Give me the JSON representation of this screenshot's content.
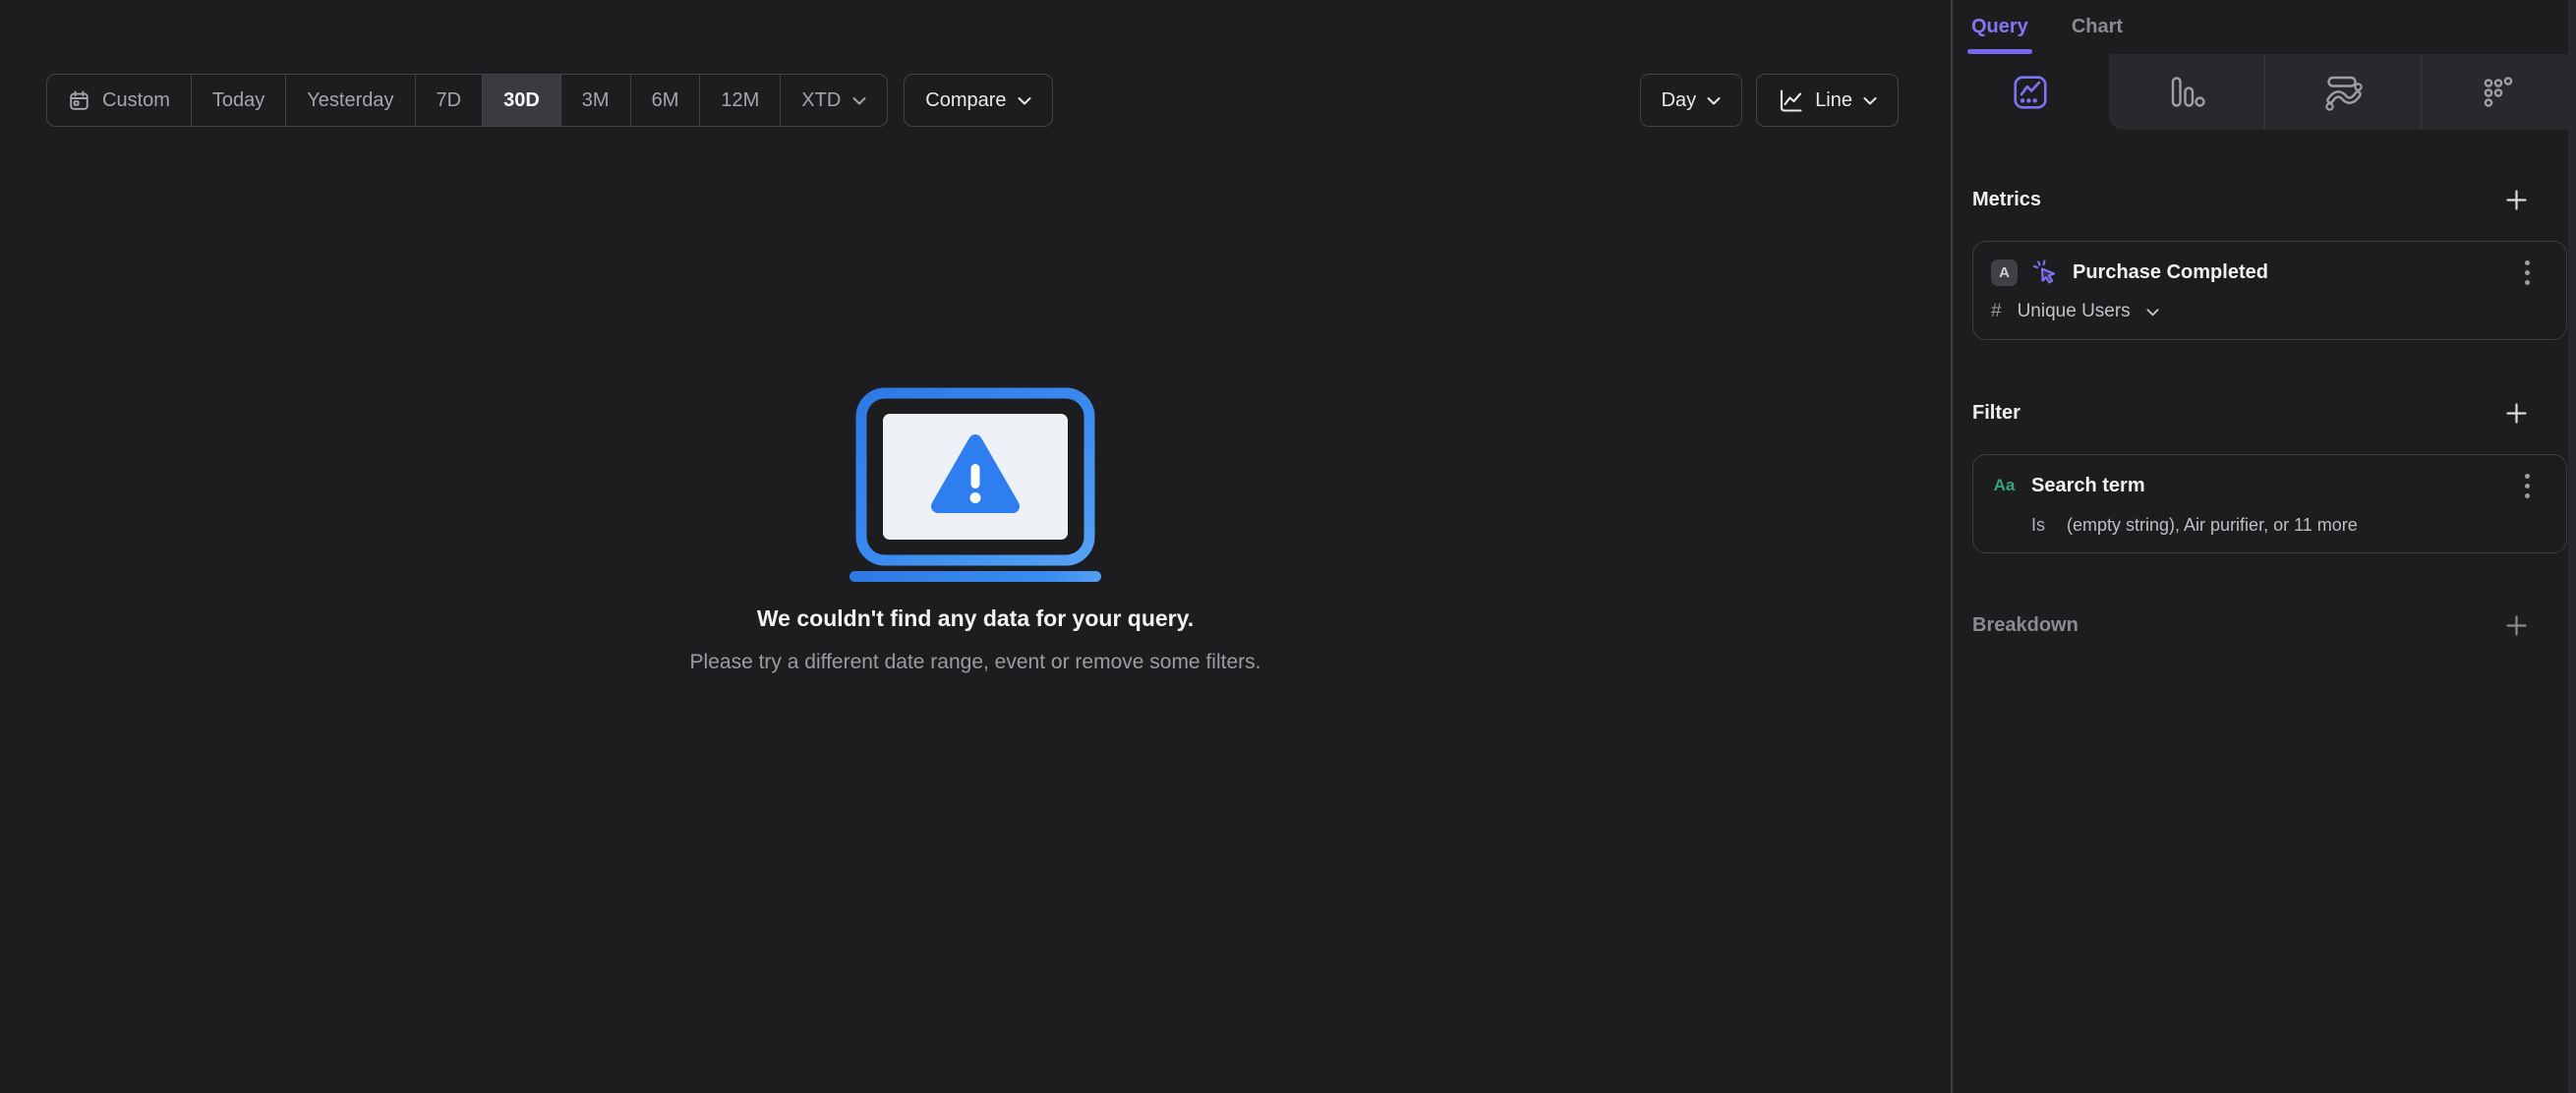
{
  "colors": {
    "accent_purple": "#7c6ff0",
    "accent_green": "#34a77c",
    "accent_blue": "#2e7ef0",
    "selected_segment_bg": "#3a3a40",
    "page_bg": "#1d1d20",
    "tabstrip_bg": "#29292d"
  },
  "icons": {
    "calendar-icon": "calendar outline",
    "chevron-down-icon": "⌄",
    "line-chart-icon": "zigzag line over axis",
    "insights-icon": "trend line in rounded square",
    "funnels-icon": "descending bars with dot",
    "flows-icon": "bar over s-curve ribbon with dots",
    "retention-icon": "triangular grid of hollow dots",
    "cursor-click-icon": "pointer with sparkle rays",
    "kebab-menu-icon": "⋮",
    "plus-icon": "+",
    "hash-symbol": "#",
    "text-property-icon": "Aa",
    "warning-laptop-illustration": "laptop with warning triangle"
  },
  "toolbar": {
    "date_ranges": [
      {
        "label": "Custom",
        "selected": false,
        "icon": "calendar-icon"
      },
      {
        "label": "Today",
        "selected": false
      },
      {
        "label": "Yesterday",
        "selected": false
      },
      {
        "label": "7D",
        "selected": false
      },
      {
        "label": "30D",
        "selected": true
      },
      {
        "label": "3M",
        "selected": false
      },
      {
        "label": "6M",
        "selected": false
      },
      {
        "label": "12M",
        "selected": false
      },
      {
        "label": "XTD",
        "selected": false,
        "has_chevron": true
      }
    ],
    "compare_label": "Compare",
    "granularity_label": "Day",
    "chart_type_label": "Line"
  },
  "empty_state": {
    "title": "We couldn't find any data for your query.",
    "subtitle": "Please try a different date range, event or remove some filters."
  },
  "sidebar": {
    "tabs": [
      {
        "label": "Query",
        "active": true
      },
      {
        "label": "Chart",
        "active": false
      }
    ],
    "view_tabs": [
      {
        "icon": "insights-icon",
        "active": true
      },
      {
        "icon": "funnels-icon",
        "active": false
      },
      {
        "icon": "flows-icon",
        "active": false
      },
      {
        "icon": "retention-icon",
        "active": false
      }
    ],
    "metrics": {
      "heading": "Metrics",
      "rows": [
        {
          "badge": "A",
          "event_icon": "cursor-click-icon",
          "event": "Purchase Completed",
          "aggregation_symbol": "#",
          "aggregation": "Unique Users"
        }
      ]
    },
    "filter": {
      "heading": "Filter",
      "rows": [
        {
          "type_icon": "Aa",
          "property": "Search term",
          "operator": "Is",
          "values": "(empty string), Air purifier, or 11 more"
        }
      ]
    },
    "breakdown": {
      "heading": "Breakdown"
    }
  }
}
